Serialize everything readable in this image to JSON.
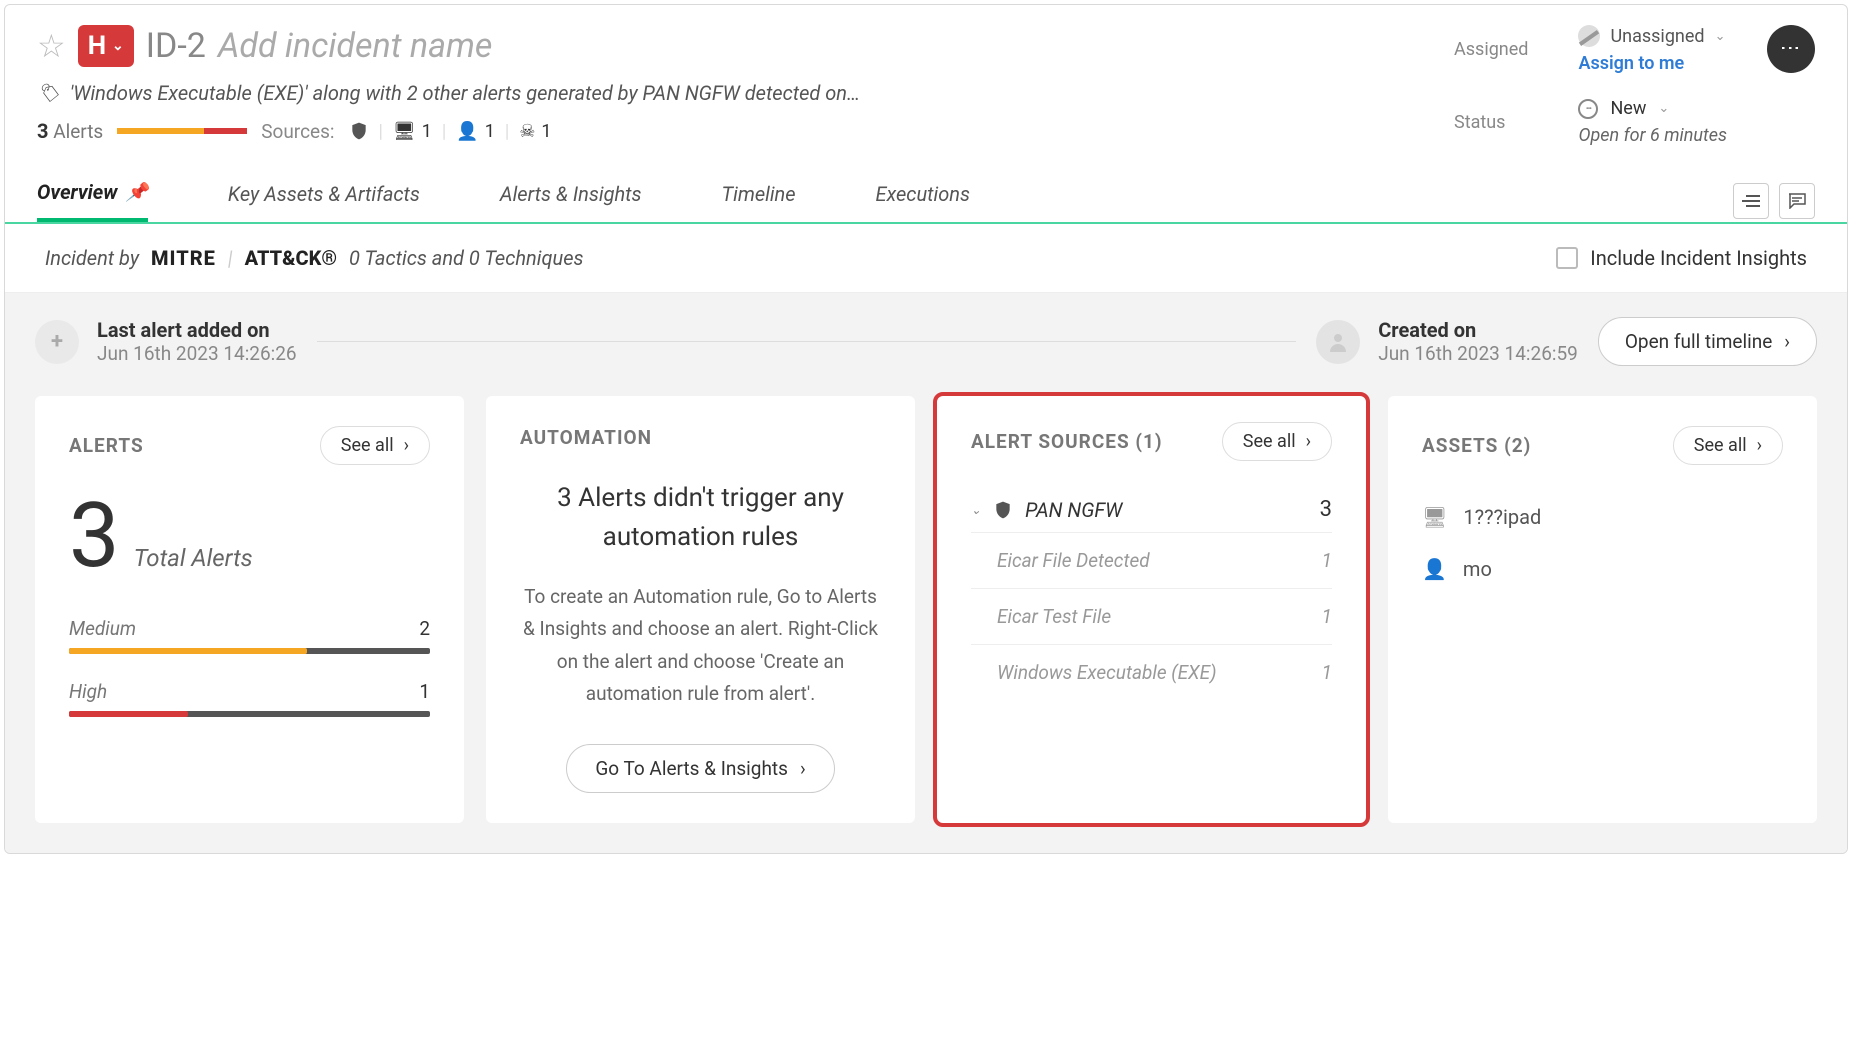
{
  "header": {
    "severity_letter": "H",
    "incident_id": "ID-2",
    "name_placeholder": "Add incident name",
    "description": "'Windows Executable (EXE)' along with 2 other alerts generated by PAN NGFW detected on…",
    "alerts_count": "3",
    "alerts_label": "Alerts",
    "sources_label": "Sources:",
    "src_shield": "",
    "src_host_count": "1",
    "src_user_count": "1",
    "src_threat_count": "1",
    "assigned_label": "Assigned",
    "unassigned_text": "Unassigned",
    "assign_to_me": "Assign to me",
    "status_label": "Status",
    "status_value": "New",
    "open_for": "Open for 6 minutes"
  },
  "tabs": {
    "overview": "Overview",
    "assets": "Key Assets & Artifacts",
    "alerts": "Alerts & Insights",
    "timeline": "Timeline",
    "executions": "Executions"
  },
  "mitre": {
    "prefix": "Incident by",
    "logo1": "MITRE",
    "logo2": "ATT&CK®",
    "stats": "0 Tactics and 0 Techniques",
    "include_label": "Include Incident Insights"
  },
  "timeline": {
    "last_alert_label": "Last alert added on",
    "last_alert_date": "Jun 16th 2023 14:26:26",
    "created_label": "Created on",
    "created_date": "Jun 16th 2023 14:26:59",
    "open_full": "Open full timeline"
  },
  "alerts_card": {
    "title": "ALERTS",
    "see_all": "See all",
    "total": "3",
    "total_label": "Total Alerts",
    "rows": [
      {
        "label": "Medium",
        "count": "2",
        "color": "#f5a623",
        "pct": 66
      },
      {
        "label": "High",
        "count": "1",
        "color": "#d63939",
        "pct": 33
      }
    ]
  },
  "automation_card": {
    "title": "AUTOMATION",
    "headline": "3 Alerts didn't trigger any automation rules",
    "desc": "To create an Automation rule, Go to Alerts & Insights and choose an alert. Right-Click on the alert and choose 'Create an automation rule from alert'.",
    "button": "Go To Alerts & Insights"
  },
  "sources_card": {
    "title": "ALERT SOURCES (1)",
    "see_all": "See all",
    "parent_name": "PAN NGFW",
    "parent_count": "3",
    "children": [
      {
        "name": "Eicar File Detected",
        "count": "1"
      },
      {
        "name": "Eicar Test File",
        "count": "1"
      },
      {
        "name": "Windows Executable (EXE)",
        "count": "1"
      }
    ]
  },
  "assets_card": {
    "title": "ASSETS (2)",
    "see_all": "See all",
    "rows": [
      {
        "icon": "host",
        "name": "1???ipad"
      },
      {
        "icon": "user",
        "name": "mo"
      }
    ]
  }
}
